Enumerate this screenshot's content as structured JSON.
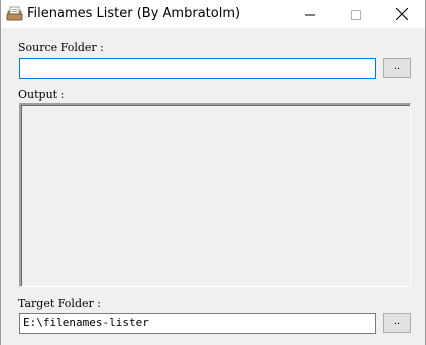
{
  "window": {
    "title": "Filenames Lister (By Ambratolm)",
    "icon": "folder-box-icon",
    "controls": [
      "minimize-icon",
      "maximize-icon",
      "close-icon"
    ]
  },
  "source": {
    "label": "Source Folder :",
    "value": "",
    "browse_label": ".."
  },
  "output": {
    "label": "Output :",
    "content": ""
  },
  "target": {
    "label": "Target Folder :",
    "value": "E:\\filenames-lister",
    "browse_label": ".."
  }
}
